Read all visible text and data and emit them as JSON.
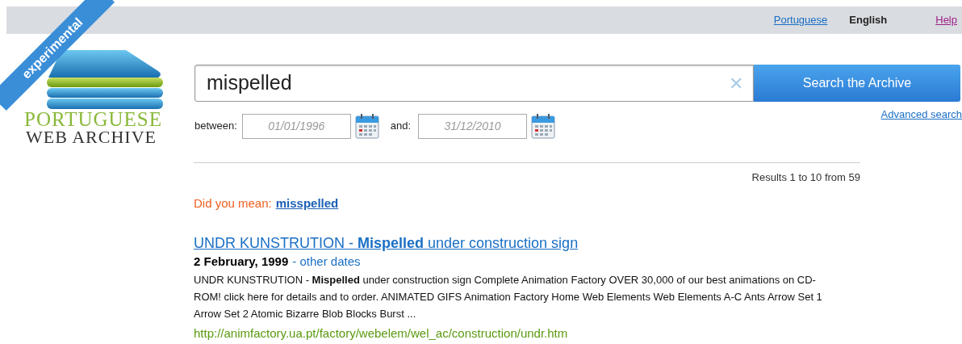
{
  "top_bar": {
    "languages": [
      {
        "label": "Portuguese",
        "selected": false
      },
      {
        "label": "English",
        "selected": true
      }
    ],
    "help": "Help"
  },
  "logo": {
    "ribbon": "experimental",
    "line_1": "PORTUGUESE",
    "line_2": "WEB ARCHIVE"
  },
  "search": {
    "value": "mispelled",
    "clear": "✕",
    "button": "Search the Archive",
    "advanced": "Advanced search"
  },
  "dates": {
    "from_label": "between:",
    "from_value": "01/01/1996",
    "to_label": "and:",
    "to_value": "31/12/2010"
  },
  "results_count": "Results 1 to 10 from 59",
  "suggestion": {
    "label": "Did you mean:",
    "term": "misspelled"
  },
  "results": [
    {
      "title": "UNDR KUNSTRUTION - **Mispelled** under construction sign",
      "date": "2 February, 1999",
      "other_dates": "- other dates",
      "snippet": "UNDR KUNSTRUTION - **Mispelled** under construction sign Complete Animation Factory OVER 30,000 of our best animations on CD-ROM! click here for details and to order. ANIMATED GIFS Animation Factory Home Web Elements Web Elements A-C Ants Arrow Set 1 Arrow Set 2 Atomic Bizarre Blob Blocks Burst ...",
      "url": "http://animfactory.ua.pt/factory/webelem/wel_ac/construction/undr.htm"
    }
  ]
}
